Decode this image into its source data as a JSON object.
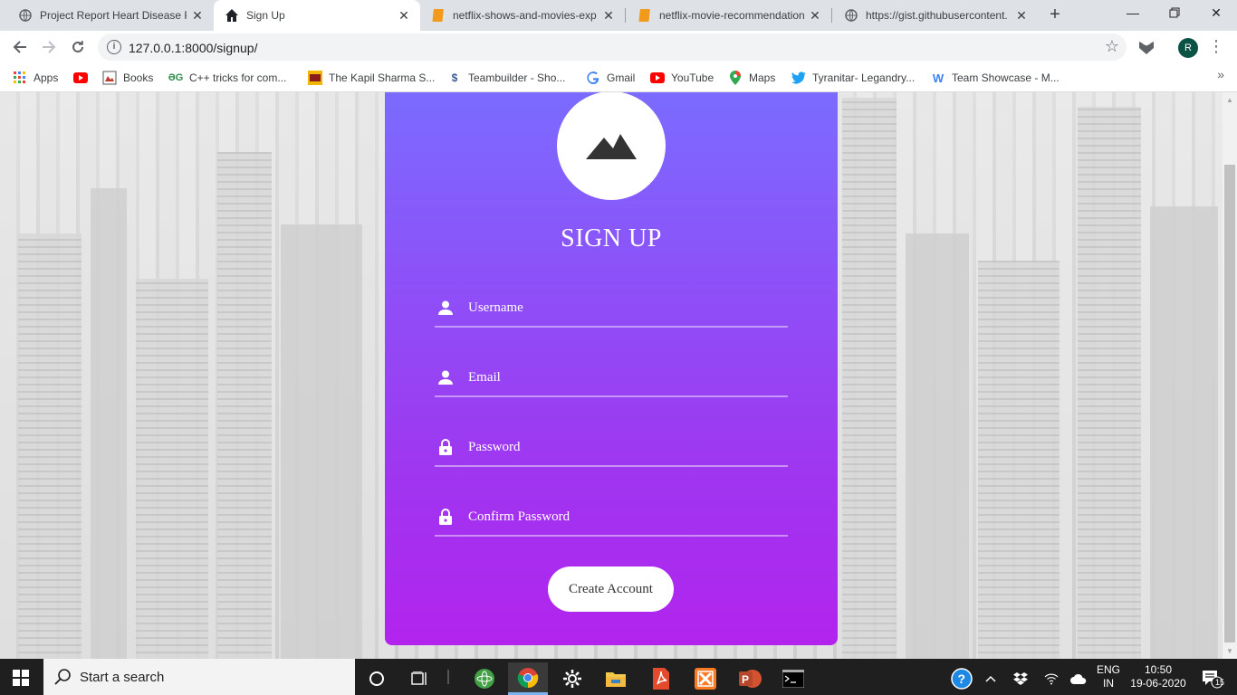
{
  "tabs": [
    {
      "title": "Project Report Heart Disease P",
      "icon": "globe-icon"
    },
    {
      "title": "Sign Up",
      "icon": "home-icon"
    },
    {
      "title": "netflix-shows-and-movies-exp",
      "icon": "notebook-icon"
    },
    {
      "title": "netflix-movie-recommendation",
      "icon": "notebook-icon"
    },
    {
      "title": "https://gist.githubusercontent.",
      "icon": "globe-icon"
    }
  ],
  "toolbar": {
    "url": "127.0.0.1:8000/signup/",
    "profile_initial": "R"
  },
  "bookmarks": [
    {
      "label": "Apps",
      "icon": "apps-grid-icon"
    },
    {
      "label": "",
      "icon": "youtube-icon"
    },
    {
      "label": "Books",
      "icon": "books-icon"
    },
    {
      "label": "C++ tricks for com...",
      "icon": "gfg-icon"
    },
    {
      "label": "The Kapil Sharma S...",
      "icon": "tv-show-icon"
    },
    {
      "label": "Teambuilder - Sho...",
      "icon": "showdown-icon"
    },
    {
      "label": "Gmail",
      "icon": "google-icon"
    },
    {
      "label": "YouTube",
      "icon": "youtube-icon"
    },
    {
      "label": "Maps",
      "icon": "maps-pin-icon"
    },
    {
      "label": "Tyranitar- Legandry...",
      "icon": "twitter-icon"
    },
    {
      "label": "Team Showcase - M...",
      "icon": "w-icon"
    }
  ],
  "signup": {
    "heading": "SIGN UP",
    "fields": [
      {
        "placeholder": "Username",
        "icon": "user-icon"
      },
      {
        "placeholder": "Email",
        "icon": "user-icon"
      },
      {
        "placeholder": "Password",
        "icon": "lock-icon"
      },
      {
        "placeholder": "Confirm Password",
        "icon": "lock-icon"
      }
    ],
    "submit_label": "Create Account"
  },
  "taskbar": {
    "search_placeholder": "Start a search",
    "lang_top": "ENG",
    "lang_bottom": "IN",
    "time": "10:50",
    "date": "19-06-2020",
    "notification_count": "15"
  },
  "colors": {
    "card_top": "#7b6bff",
    "card_bottom": "#b224ee",
    "taskbar": "#1f1f1f"
  }
}
